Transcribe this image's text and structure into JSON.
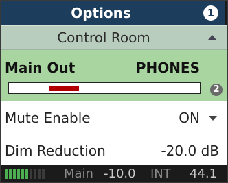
{
  "header": {
    "title": "Options",
    "badge": "1"
  },
  "section": {
    "label": "Control Room"
  },
  "main_out": {
    "label": "Main Out",
    "value": "PHONES",
    "meter_level_fraction": 0.16,
    "meter_fill_color": "#b00000",
    "badge": "2"
  },
  "rows": [
    {
      "name": "Mute Enable",
      "value": "ON"
    },
    {
      "name": "Dim Reduction",
      "value": "-20.0 dB"
    }
  ],
  "status": {
    "main": "Main",
    "level": "-10.0",
    "int": "INT",
    "rate": "44.1",
    "meter_active_bars": 6,
    "meter_total_bars": 10,
    "meter_active_color": "#4caf50",
    "meter_inactive_color": "#3a3a3a"
  },
  "colors": {
    "titlebar": "#1d3d5c",
    "section": "#b9cdbf",
    "selected": "#a9d6a0"
  }
}
